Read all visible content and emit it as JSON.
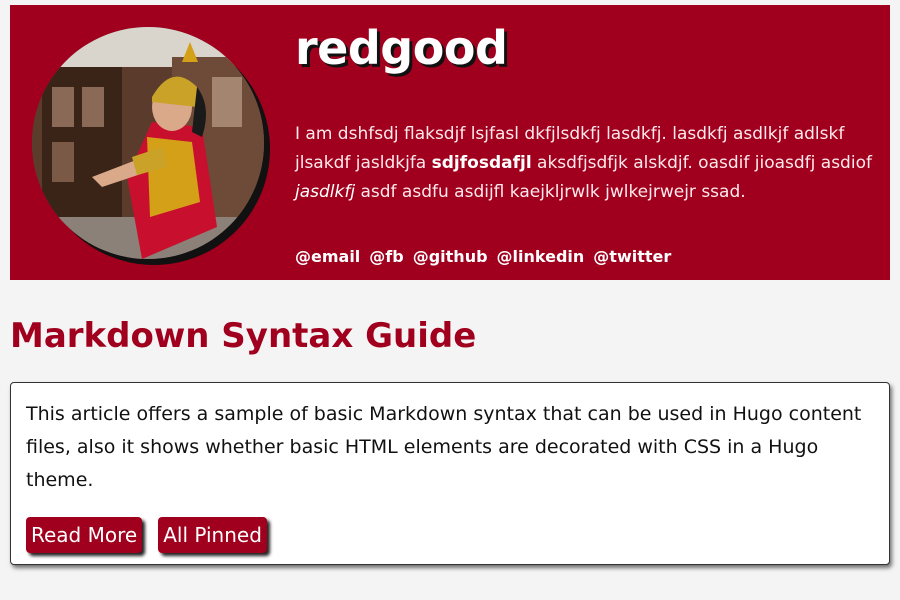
{
  "site": {
    "title": "redgood",
    "bio": {
      "part1": "I am dshfsdj flaksdjf lsjfasl dkfjlsdkfj lasdkfj. lasdkfj asdlkjf adlskf jlsakdf jasldkjfa ",
      "bold": "sdjfosdafjl",
      "part2": " aksdfjsdfjk alskdjf. oasdif jioasdfj asdiof ",
      "italic": "jasdlkfj",
      "part3": " asdf asdfu asdijfl kaejkljrwlk jwlkejrwejr ssad."
    },
    "social": [
      {
        "label": "@email"
      },
      {
        "label": "@fb"
      },
      {
        "label": "@github"
      },
      {
        "label": "@linkedin"
      },
      {
        "label": "@twitter"
      }
    ],
    "colors": {
      "brand": "#a0001d",
      "background": "#f4f4f4"
    }
  },
  "article": {
    "title": "Markdown Syntax Guide",
    "summary": "This article offers a sample of basic Markdown syntax that can be used in Hugo content files, also it shows whether basic HTML elements are decorated with CSS in a Hugo theme.",
    "buttons": {
      "read_more": "Read More",
      "all_pinned": "All Pinned"
    }
  }
}
